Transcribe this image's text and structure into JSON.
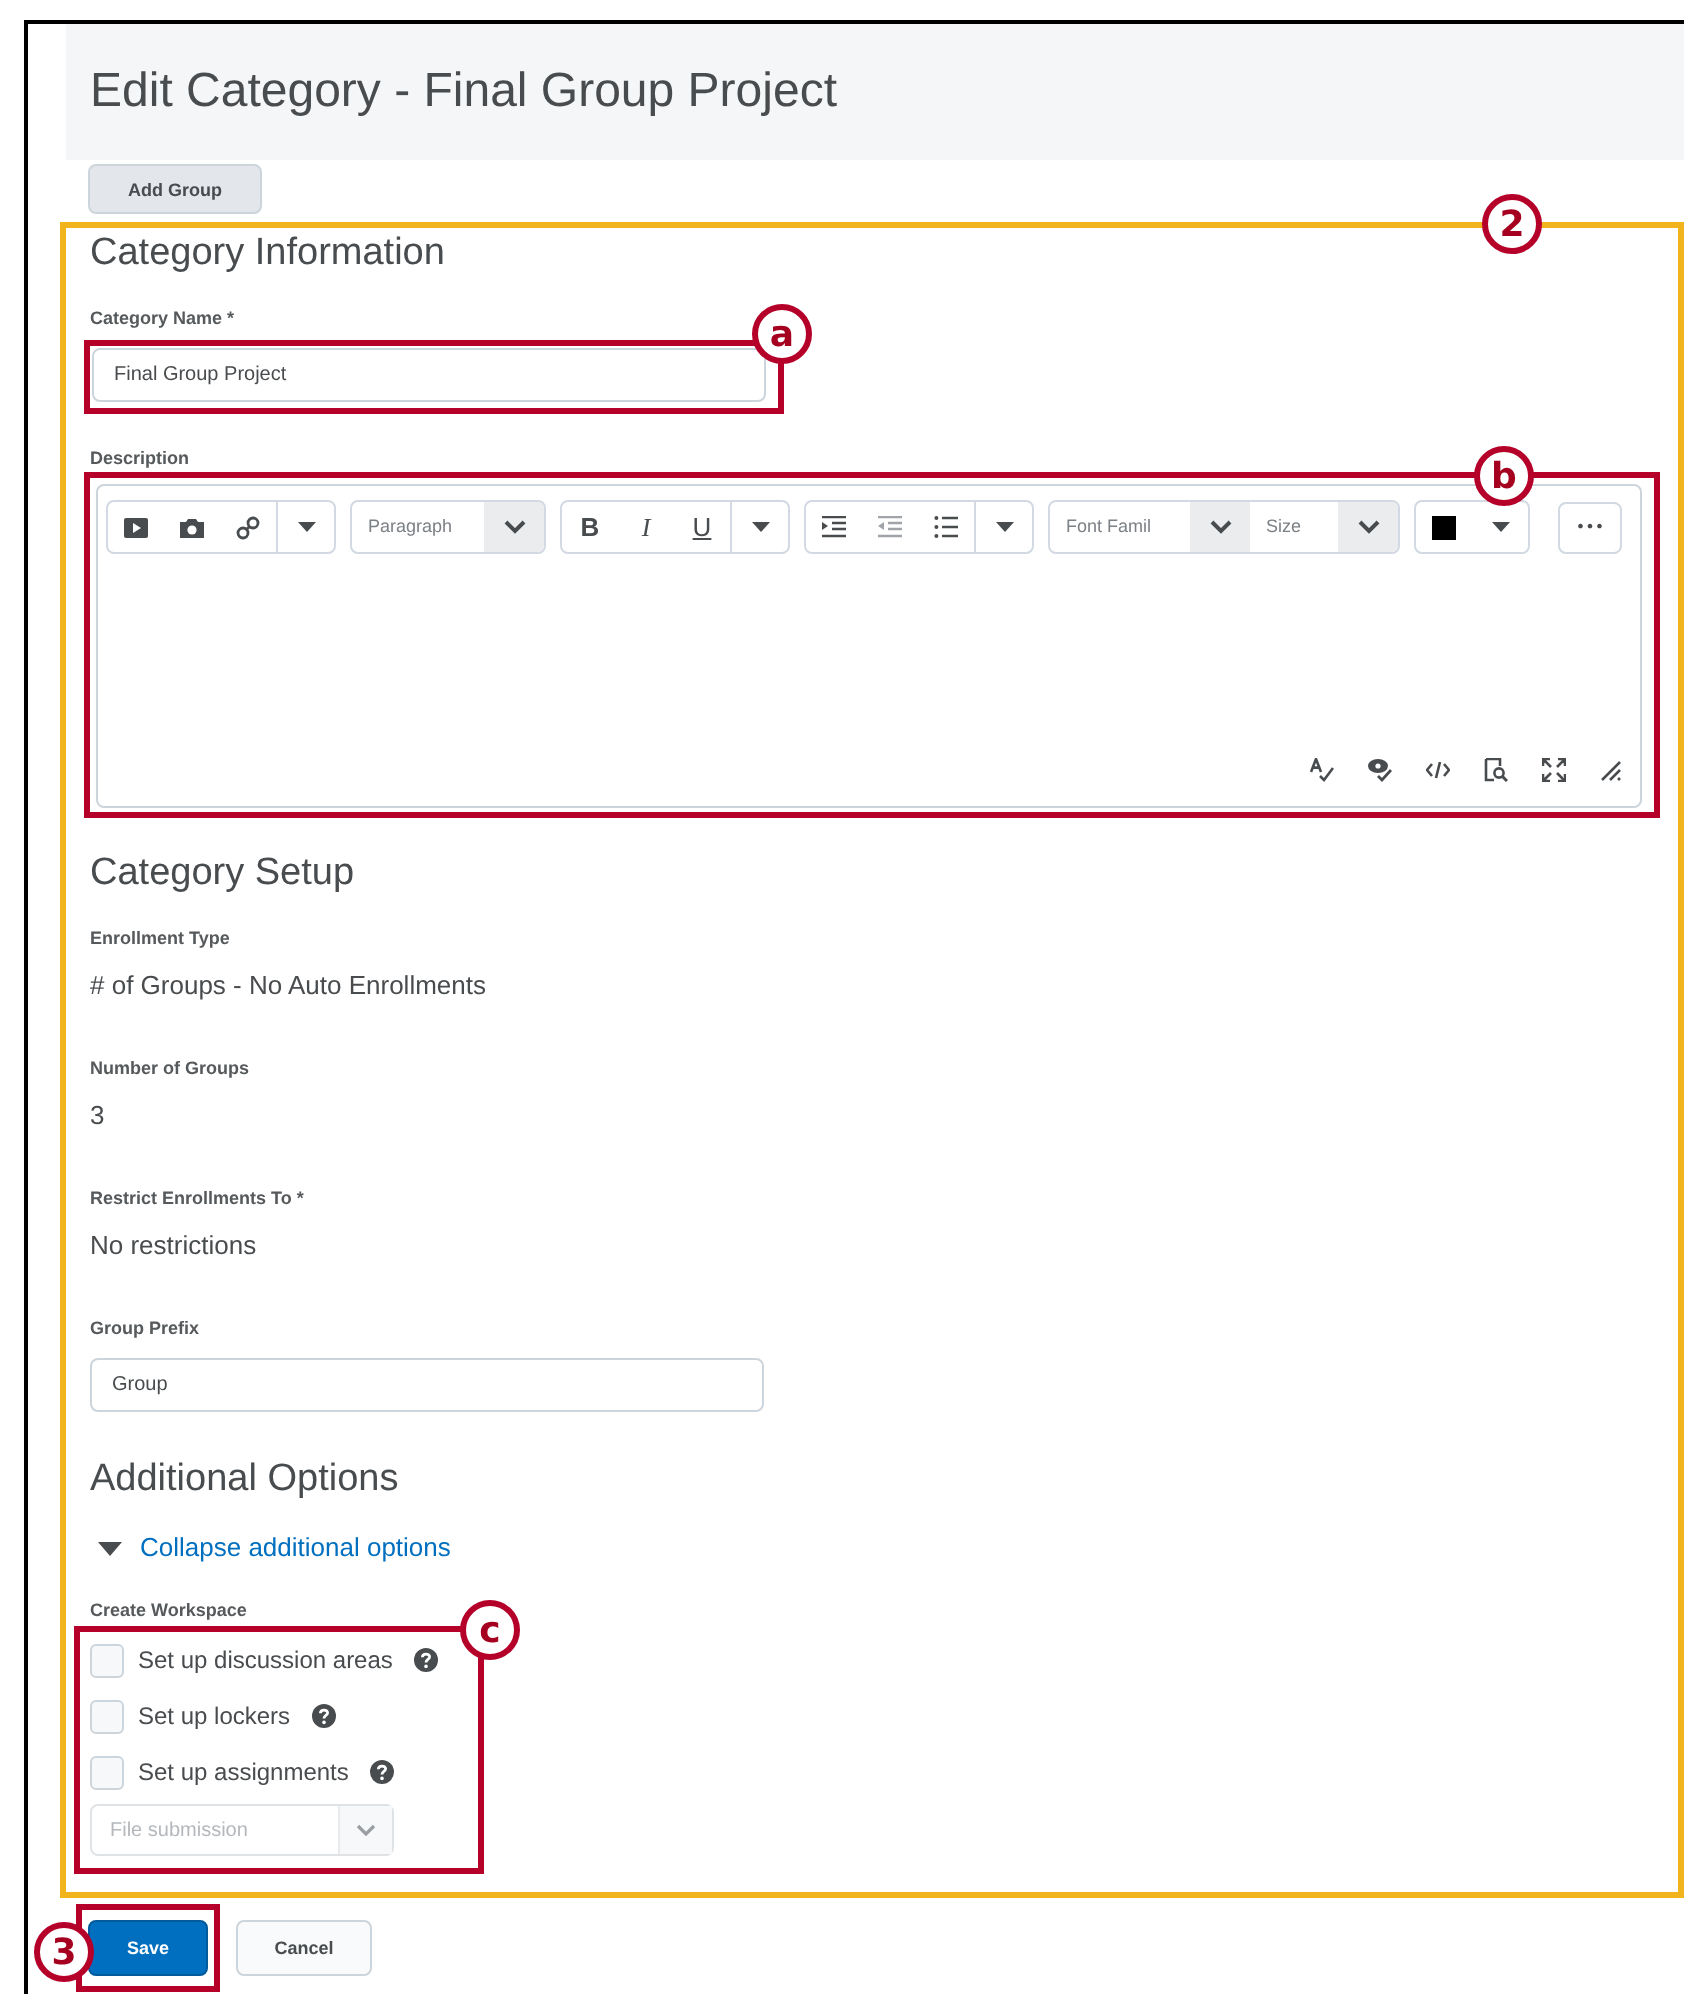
{
  "page": {
    "title": "Edit Category - Final Group Project"
  },
  "add_group_button": "Add Group",
  "annotations": {
    "section": "2",
    "name": "a",
    "description": "b",
    "workspace": "c",
    "save": "3"
  },
  "category_information": {
    "heading": "Category Information",
    "name_label": "Category Name *",
    "name_value": "Final Group Project",
    "description_label": "Description",
    "editor": {
      "format": "Paragraph",
      "bold": "B",
      "italic": "I",
      "underline": "U",
      "font_family": "Font Famil",
      "size": "Size",
      "more": "•••"
    }
  },
  "category_setup": {
    "heading": "Category Setup",
    "fields": [
      {
        "label": "Enrollment Type",
        "kind": "text",
        "value": "# of Groups - No Auto Enrollments"
      },
      {
        "label": "Number of Groups",
        "kind": "text",
        "value": "3"
      },
      {
        "label": "Restrict Enrollments To *",
        "kind": "text",
        "value": "No restrictions"
      },
      {
        "label": "Group Prefix",
        "kind": "input",
        "value": "Group"
      }
    ]
  },
  "additional_options": {
    "heading": "Additional Options",
    "toggle": {
      "label": "Collapse additional options",
      "expanded": true
    },
    "workspace_label": "Create Workspace",
    "options": [
      {
        "label": "Set up discussion areas",
        "checked": false
      },
      {
        "label": "Set up lockers",
        "checked": false
      },
      {
        "label": "Set up assignments",
        "checked": false
      }
    ],
    "submission_select": {
      "value": "File submission",
      "disabled": true
    }
  },
  "buttons": [
    {
      "label": "Save",
      "kind": "primary"
    },
    {
      "label": "Cancel",
      "kind": "secondary"
    }
  ]
}
